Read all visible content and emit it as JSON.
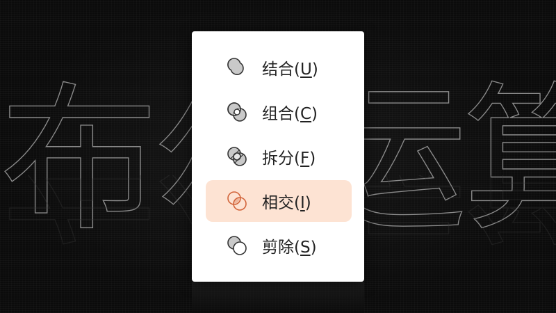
{
  "background": {
    "title_chars": [
      "布",
      "尔",
      "运",
      "算"
    ]
  },
  "menu": {
    "items": [
      {
        "label": "结合",
        "key": "U",
        "icon": "union-icon",
        "active": false
      },
      {
        "label": "组合",
        "key": "C",
        "icon": "combine-icon",
        "active": false
      },
      {
        "label": "拆分",
        "key": "F",
        "icon": "fragment-icon",
        "active": false
      },
      {
        "label": "相交",
        "key": "I",
        "icon": "intersect-icon",
        "active": true
      },
      {
        "label": "剪除",
        "key": "S",
        "icon": "subtract-icon",
        "active": false
      }
    ]
  },
  "colors": {
    "active_bg": "#fde3d3",
    "active_icon": "#d2643a",
    "background": "#0b0b0b"
  }
}
